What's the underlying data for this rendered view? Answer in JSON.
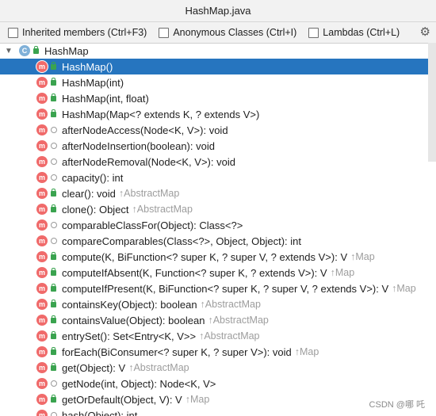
{
  "window": {
    "title": "HashMap.java"
  },
  "options": {
    "inherited_members": "Inherited members (Ctrl+F3)",
    "anonymous_classes": "Anonymous Classes (Ctrl+I)",
    "lambdas": "Lambdas (Ctrl+L)",
    "settings_icon": "gear-icon"
  },
  "tree": {
    "root": {
      "label": "HashMap",
      "icon": "class-icon",
      "expanded": true
    },
    "members": [
      {
        "name": "HashMap()",
        "vis": "public",
        "inherited_from": "",
        "selected": true
      },
      {
        "name": "HashMap(int)",
        "vis": "public",
        "inherited_from": ""
      },
      {
        "name": "HashMap(int, float)",
        "vis": "public",
        "inherited_from": ""
      },
      {
        "name": "HashMap(Map<? extends K, ? extends V>)",
        "vis": "public",
        "inherited_from": ""
      },
      {
        "name": "afterNodeAccess(Node<K, V>): void",
        "vis": "package",
        "inherited_from": ""
      },
      {
        "name": "afterNodeInsertion(boolean): void",
        "vis": "package",
        "inherited_from": ""
      },
      {
        "name": "afterNodeRemoval(Node<K, V>): void",
        "vis": "package",
        "inherited_from": ""
      },
      {
        "name": "capacity(): int",
        "vis": "package",
        "inherited_from": ""
      },
      {
        "name": "clear(): void",
        "vis": "public",
        "inherited_from": "↑AbstractMap"
      },
      {
        "name": "clone(): Object",
        "vis": "public",
        "inherited_from": "↑AbstractMap"
      },
      {
        "name": "comparableClassFor(Object): Class<?>",
        "vis": "package",
        "inherited_from": ""
      },
      {
        "name": "compareComparables(Class<?>, Object, Object): int",
        "vis": "package",
        "inherited_from": ""
      },
      {
        "name": "compute(K, BiFunction<? super K, ? super V, ? extends V>): V",
        "vis": "public",
        "inherited_from": "↑Map"
      },
      {
        "name": "computeIfAbsent(K, Function<? super K, ? extends V>): V",
        "vis": "public",
        "inherited_from": "↑Map"
      },
      {
        "name": "computeIfPresent(K, BiFunction<? super K, ? super V, ? extends V>): V",
        "vis": "public",
        "inherited_from": "↑Map"
      },
      {
        "name": "containsKey(Object): boolean",
        "vis": "public",
        "inherited_from": "↑AbstractMap"
      },
      {
        "name": "containsValue(Object): boolean",
        "vis": "public",
        "inherited_from": "↑AbstractMap"
      },
      {
        "name": "entrySet(): Set<Entry<K, V>>",
        "vis": "public",
        "inherited_from": "↑AbstractMap"
      },
      {
        "name": "forEach(BiConsumer<? super K, ? super V>): void",
        "vis": "public",
        "inherited_from": "↑Map"
      },
      {
        "name": "get(Object): V",
        "vis": "public",
        "inherited_from": "↑AbstractMap"
      },
      {
        "name": "getNode(int, Object): Node<K, V>",
        "vis": "package",
        "inherited_from": ""
      },
      {
        "name": "getOrDefault(Object, V): V",
        "vis": "public",
        "inherited_from": "↑Map"
      },
      {
        "name": "hash(Object): int",
        "vis": "package",
        "inherited_from": ""
      }
    ]
  },
  "watermark": "CSDN @哪 吒"
}
